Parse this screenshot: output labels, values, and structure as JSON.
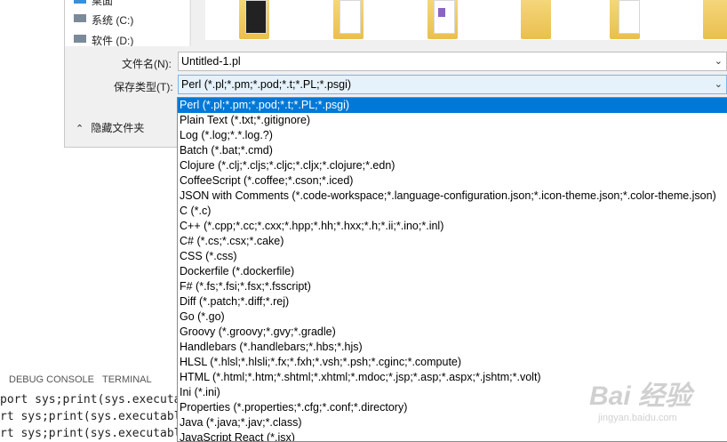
{
  "panel": {
    "tabs": [
      "DEBUG CONSOLE",
      "TERMINAL"
    ],
    "terminal_lines": [
      "port sys;print(sys.executa",
      "rt sys;print(sys.executabl",
      "rt sys;print(sys.executabl"
    ]
  },
  "dialog": {
    "nav_items": [
      "桌面",
      "系统 (C:)",
      "软件 (D:)"
    ],
    "filename_label": "文件名(N):",
    "filename_value": "Untitled-1.pl",
    "filetype_label": "保存类型(T):",
    "filetype_selected": "Perl (*.pl;*.pm;*.pod;*.t;*.PL;*.psgi)",
    "hide_folders_label": "隐藏文件夹",
    "colors": {
      "accent": "#0078d7",
      "select_bg": "#e5f1fb",
      "select_border": "#7eb4ea"
    }
  },
  "dropdown": {
    "options": [
      "Perl (*.pl;*.pm;*.pod;*.t;*.PL;*.psgi)",
      "Plain Text (*.txt;*.gitignore)",
      "Log (*.log;*.*.log.?)",
      "Batch (*.bat;*.cmd)",
      "Clojure (*.clj;*.cljs;*.cljc;*.cljx;*.clojure;*.edn)",
      "CoffeeScript (*.coffee;*.cson;*.iced)",
      "JSON with Comments (*.code-workspace;*.language-configuration.json;*.icon-theme.json;*.color-theme.json)",
      "C (*.c)",
      "C++ (*.cpp;*.cc;*.cxx;*.hpp;*.hh;*.hxx;*.h;*.ii;*.ino;*.inl)",
      "C# (*.cs;*.csx;*.cake)",
      "CSS (*.css)",
      "Dockerfile (*.dockerfile)",
      "F# (*.fs;*.fsi;*.fsx;*.fsscript)",
      "Diff (*.patch;*.diff;*.rej)",
      "Go (*.go)",
      "Groovy (*.groovy;*.gvy;*.gradle)",
      "Handlebars (*.handlebars;*.hbs;*.hjs)",
      "HLSL (*.hlsl;*.hlsli;*.fx;*.fxh;*.vsh;*.psh;*.cginc;*.compute)",
      "HTML (*.html;*.htm;*.shtml;*.xhtml;*.mdoc;*.jsp;*.asp;*.aspx;*.jshtm;*.volt)",
      "Ini (*.ini)",
      "Properties (*.properties;*.cfg;*.conf;*.directory)",
      "Java (*.java;*.jav;*.class)",
      "JavaScript React (*.jsx)"
    ],
    "selected_index": 0
  },
  "watermark": {
    "main": "Bai  经验",
    "sub": "jingyan.baidu.com"
  }
}
